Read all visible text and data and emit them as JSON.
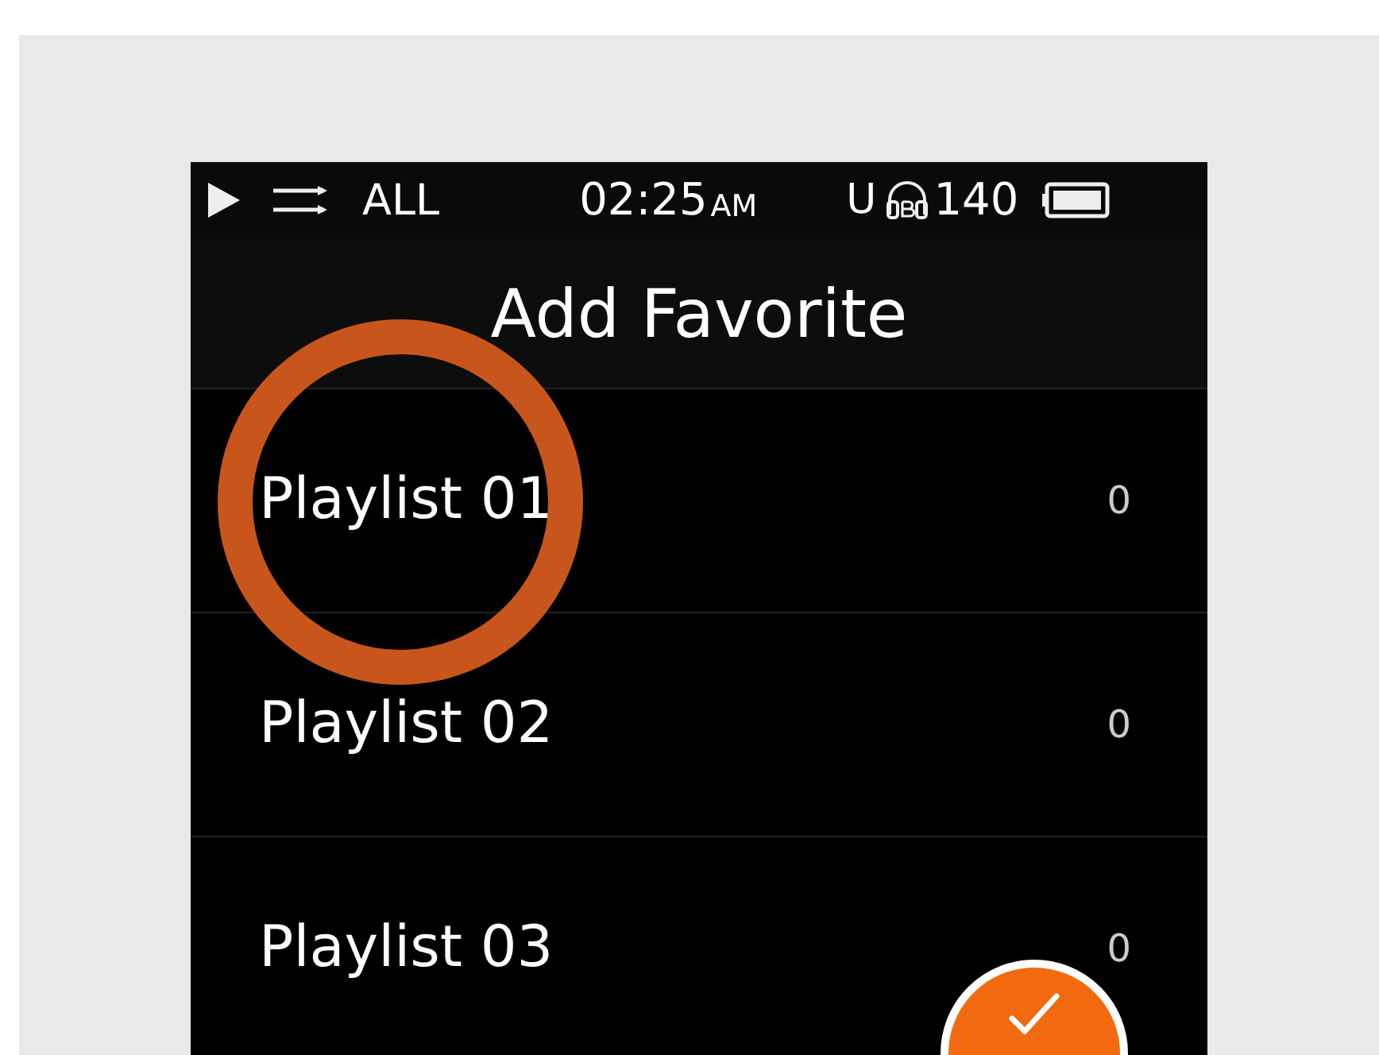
{
  "status_bar": {
    "repeat": "ALL",
    "time": "02:25",
    "meridiem": "AM",
    "usb": "U",
    "volume": "140"
  },
  "title": "Add Favorite",
  "playlists": [
    {
      "name": "Playlist 01",
      "count": "0",
      "highlighted": true
    },
    {
      "name": "Playlist 02",
      "count": "0",
      "highlighted": false
    },
    {
      "name": "Playlist 03",
      "count": "0",
      "highlighted": false
    }
  ]
}
